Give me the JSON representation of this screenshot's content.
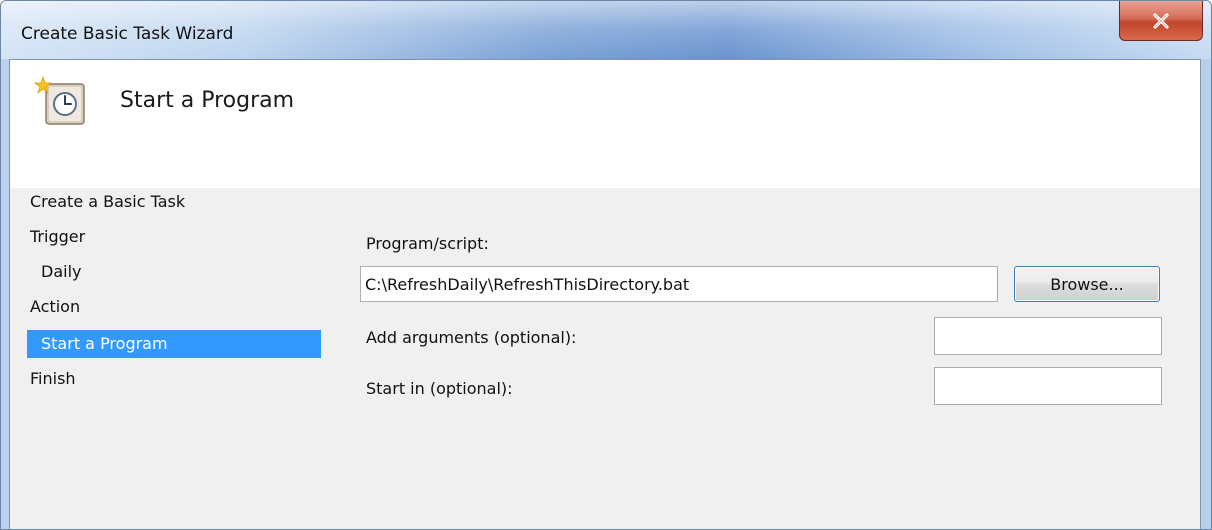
{
  "window": {
    "title": "Create Basic Task Wizard",
    "close_icon": "close-icon"
  },
  "header": {
    "title": "Start a Program",
    "icon": "scheduled-task-clock-icon"
  },
  "steps": [
    {
      "label": "Create a Basic Task",
      "selected": false
    },
    {
      "label": "Trigger",
      "selected": false
    },
    {
      "label": "Daily",
      "selected": false
    },
    {
      "label": "Action",
      "selected": false
    },
    {
      "label": "Start a Program",
      "selected": true
    },
    {
      "label": "Finish",
      "selected": false
    }
  ],
  "form": {
    "program_label": "Program/script:",
    "program_value": "C:\\RefreshDaily\\RefreshThisDirectory.bat",
    "browse_label": "Browse...",
    "arguments_label": "Add arguments (optional):",
    "arguments_value": "",
    "start_in_label": "Start in (optional):",
    "start_in_value": ""
  },
  "colors": {
    "selection": "#3399ff",
    "close_button": "#c7452d",
    "panel_background": "#f0f0f0"
  }
}
